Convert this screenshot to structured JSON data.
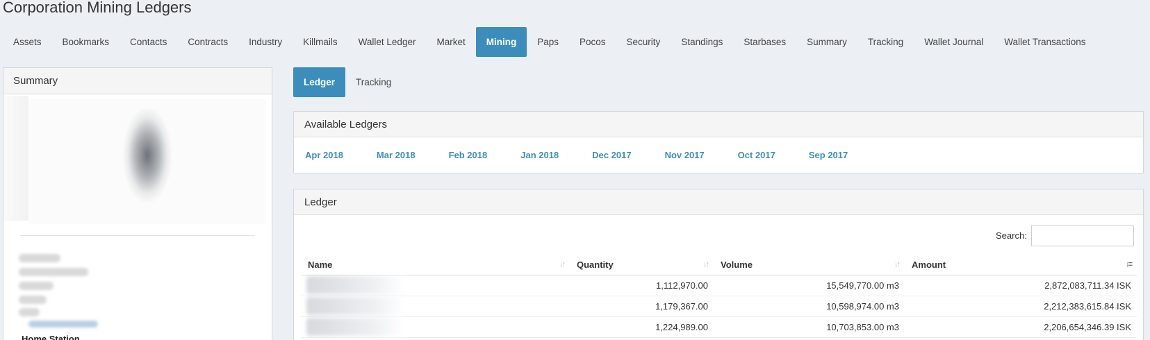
{
  "page": {
    "title": "Corporation Mining Ledgers"
  },
  "nav": {
    "tabs": [
      "Assets",
      "Bookmarks",
      "Contacts",
      "Contracts",
      "Industry",
      "Killmails",
      "Wallet Ledger",
      "Market",
      "Mining",
      "Paps",
      "Pocos",
      "Security",
      "Standings",
      "Starbases",
      "Summary",
      "Tracking",
      "Wallet Journal",
      "Wallet Transactions"
    ],
    "active": "Mining"
  },
  "summary": {
    "title": "Summary",
    "home_station_label": "Home Station"
  },
  "subtabs": {
    "items": [
      "Ledger",
      "Tracking"
    ],
    "active": "Ledger"
  },
  "available_ledgers": {
    "title": "Available Ledgers",
    "months": [
      "Apr 2018",
      "Mar 2018",
      "Feb 2018",
      "Jan 2018",
      "Dec 2017",
      "Nov 2017",
      "Oct 2017",
      "Sep 2017"
    ]
  },
  "ledger": {
    "title": "Ledger",
    "search_label": "Search:",
    "search_value": "",
    "columns": [
      "Name",
      "Quantity",
      "Volume",
      "Amount"
    ],
    "rows": [
      {
        "name": "",
        "quantity": "1,112,970.00",
        "volume": "15,549,770.00 m3",
        "amount": "2,872,083,711.34 ISK"
      },
      {
        "name": "",
        "quantity": "1,179,367.00",
        "volume": "10,598,974.00 m3",
        "amount": "2,212,383,615.84 ISK"
      },
      {
        "name": "",
        "quantity": "1,224,989.00",
        "volume": "10,703,853.00 m3",
        "amount": "2,206,654,346.39 ISK"
      }
    ]
  },
  "colors": {
    "accent": "#3c8dbc",
    "background": "#ecf0f5"
  },
  "icons": {
    "sort": "sort-both-icon",
    "sort_active": "sort-desc-icon"
  }
}
